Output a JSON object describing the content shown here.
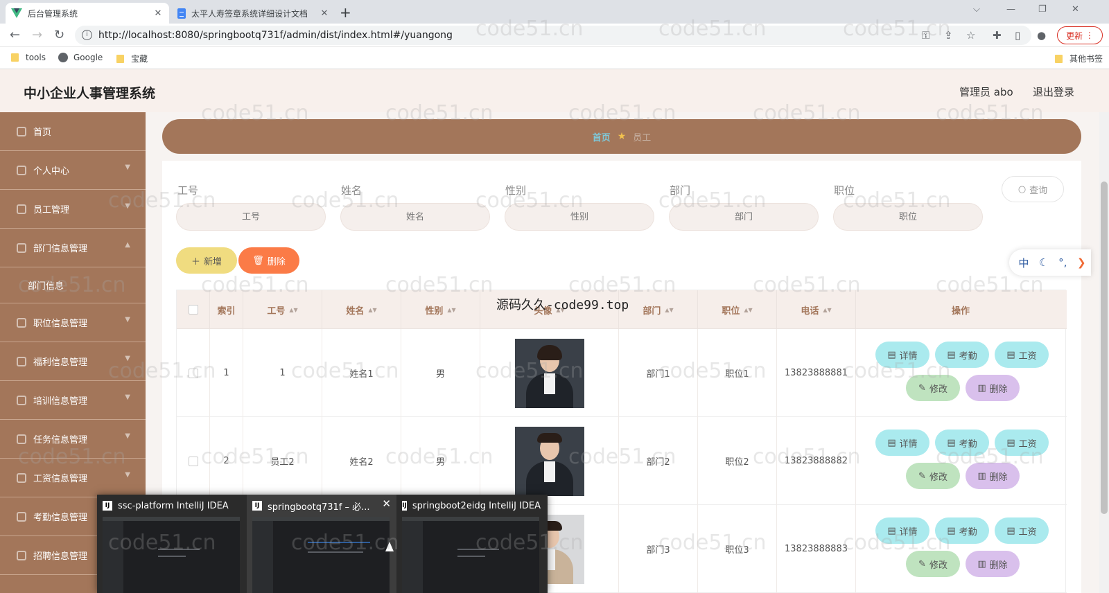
{
  "browser": {
    "tabs": [
      {
        "title": "后台管理系统"
      },
      {
        "title": "太平人寿签章系统详细设计文档"
      }
    ],
    "url": "http://localhost:8080/springbootq731f/admin/dist/index.html#/yuangong",
    "update_label": "更新",
    "bookmarks": [
      "tools",
      "Google",
      "宝藏"
    ],
    "other_bookmarks": "其他书签"
  },
  "app": {
    "title": "中小企业人事管理系统",
    "user": "管理员 abo",
    "logout": "退出登录"
  },
  "sidebar": {
    "items": [
      {
        "label": "首页"
      },
      {
        "label": "个人中心"
      },
      {
        "label": "员工管理"
      },
      {
        "label": "部门信息管理"
      },
      {
        "label": "部门信息"
      },
      {
        "label": "职位信息管理"
      },
      {
        "label": "福利信息管理"
      },
      {
        "label": "培训信息管理"
      },
      {
        "label": "任务信息管理"
      },
      {
        "label": "工资信息管理"
      },
      {
        "label": "考勤信息管理"
      },
      {
        "label": "招聘信息管理"
      }
    ]
  },
  "breadcrumb": {
    "home": "首页",
    "current": "员工"
  },
  "filters": [
    {
      "label": "工号",
      "placeholder": "工号"
    },
    {
      "label": "姓名",
      "placeholder": "姓名"
    },
    {
      "label": "性别",
      "placeholder": "性别"
    },
    {
      "label": "部门",
      "placeholder": "部门"
    },
    {
      "label": "职位",
      "placeholder": "职位"
    }
  ],
  "search_label": "查询",
  "add_label": "新增",
  "delete_label": "删除",
  "lang_bar": {
    "lang": "中"
  },
  "table": {
    "headers": {
      "index": "索引",
      "gonghao": "工号",
      "name": "姓名",
      "gender": "性别",
      "photo": "头像",
      "dept": "部门",
      "position": "职位",
      "phone": "电话",
      "action": "操作"
    },
    "rows": [
      {
        "index": "1",
        "gonghao": "1",
        "name": "姓名1",
        "gender": "男",
        "dept": "部门1",
        "position": "职位1",
        "phone": "13823888881"
      },
      {
        "index": "2",
        "gonghao": "员工2",
        "name": "姓名2",
        "gender": "男",
        "dept": "部门2",
        "position": "职位2",
        "phone": "13823888882"
      },
      {
        "index": "",
        "gonghao": "",
        "name": "",
        "gender": "",
        "dept": "部门3",
        "position": "职位3",
        "phone": "13823888883"
      }
    ],
    "actions": {
      "detail": "详情",
      "attendance": "考勤",
      "salary": "工资",
      "edit": "修改",
      "delete": "删除"
    }
  },
  "taskbar_preview": [
    {
      "title": "ssc-platform IntelliJ IDEA"
    },
    {
      "title": "springbootq731f – 必..."
    },
    {
      "title": "springboot2eidg IntelliJ IDEA"
    }
  ],
  "watermark": "code51.cn",
  "overlay_text": "源码久久-code99.top"
}
